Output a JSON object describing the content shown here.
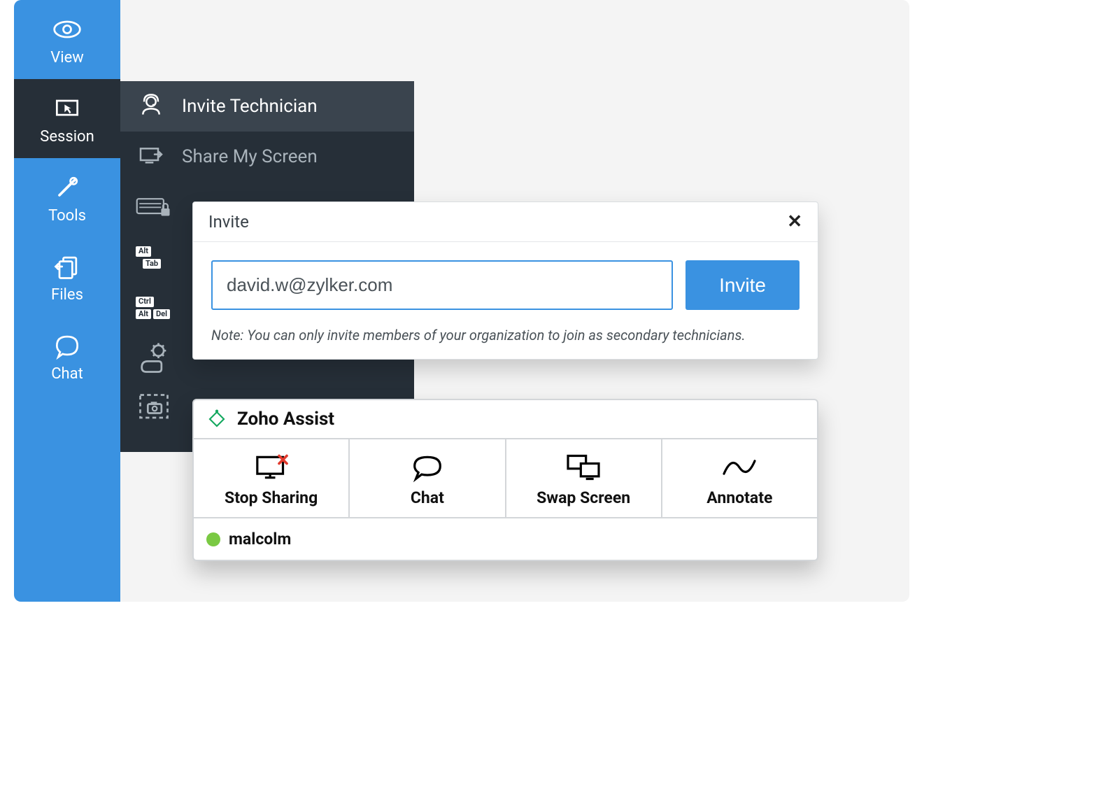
{
  "sidebar": {
    "items": [
      {
        "label": "View"
      },
      {
        "label": "Session"
      },
      {
        "label": "Tools"
      },
      {
        "label": "Files"
      },
      {
        "label": "Chat"
      }
    ]
  },
  "submenu": {
    "invite_technician": "Invite Technician",
    "share_my_screen": "Share My Screen"
  },
  "invite_dialog": {
    "title": "Invite",
    "email_value": "david.w@zylker.com",
    "button_label": "Invite",
    "note": "Note: You can only invite members of your organization to join as secondary technicians."
  },
  "assist_panel": {
    "product_name": "Zoho Assist",
    "actions": [
      {
        "label": "Stop Sharing"
      },
      {
        "label": "Chat"
      },
      {
        "label": "Swap Screen"
      },
      {
        "label": "Annotate"
      }
    ],
    "user": "malcolm"
  },
  "colors": {
    "primary": "#3a92e1",
    "sidebar_dark": "#262f38"
  }
}
